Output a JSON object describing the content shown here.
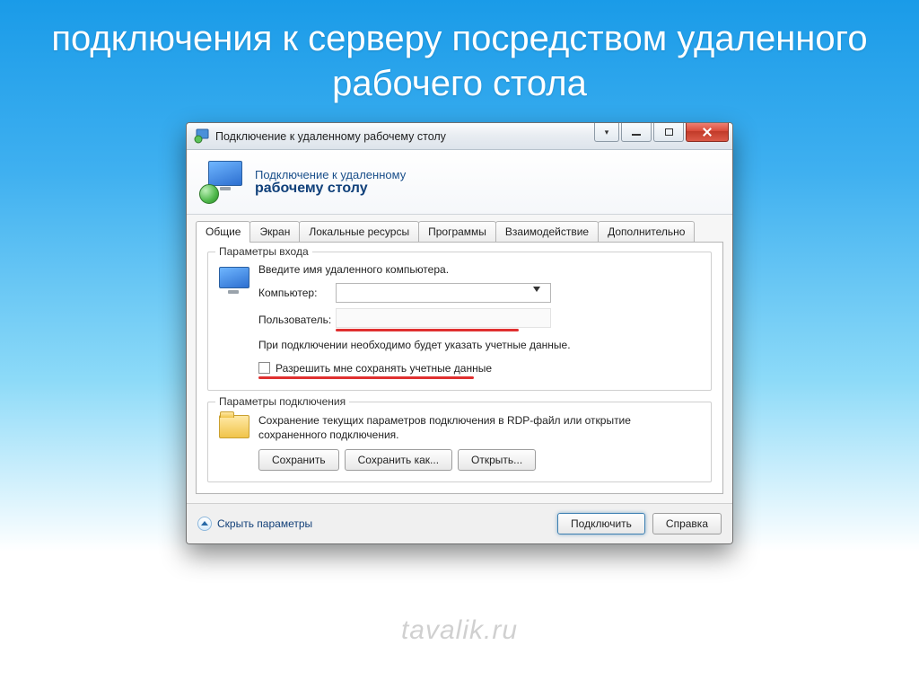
{
  "slide": {
    "title": "подключения к серверу посредством удаленного рабочего стола"
  },
  "titlebar": {
    "text": "Подключение к удаленному рабочему столу"
  },
  "banner": {
    "line1": "Подключение к удаленному",
    "line2": "рабочему столу"
  },
  "tabs": [
    "Общие",
    "Экран",
    "Локальные ресурсы",
    "Программы",
    "Взаимодействие",
    "Дополнительно"
  ],
  "login_group": {
    "legend": "Параметры входа",
    "instruction": "Введите имя удаленного компьютера.",
    "computer_label": "Компьютер:",
    "computer_value": "",
    "user_label": "Пользователь:",
    "note": "При подключении необходимо будет указать учетные данные.",
    "checkbox_label": "Разрешить мне сохранять учетные данные"
  },
  "conn_group": {
    "legend": "Параметры подключения",
    "text": "Сохранение текущих параметров подключения в RDP-файл или открытие сохраненного подключения.",
    "save": "Сохранить",
    "save_as": "Сохранить как...",
    "open": "Открыть..."
  },
  "footer": {
    "hide_params": "Скрыть параметры",
    "connect": "Подключить",
    "help": "Справка"
  },
  "watermark": "tavalik.ru"
}
